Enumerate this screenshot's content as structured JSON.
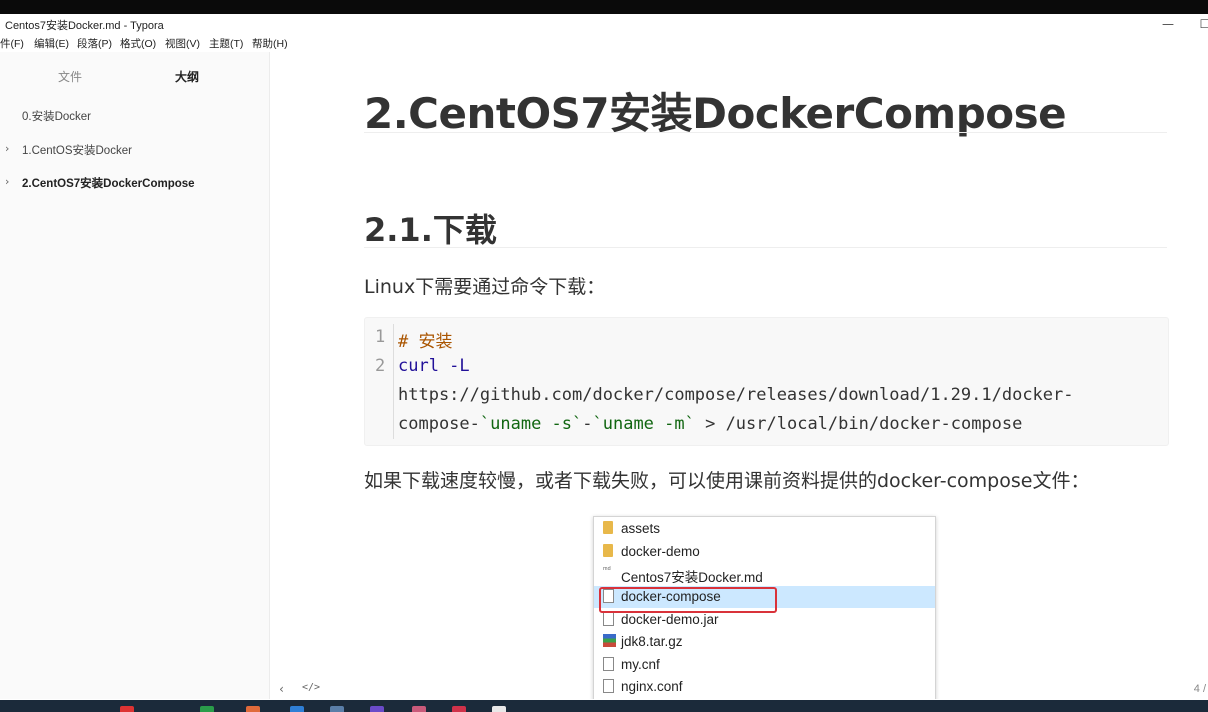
{
  "window": {
    "title": "Centos7安装Docker.md - Typora",
    "minimize_label": "—",
    "maximize_label": "☐"
  },
  "menu": [
    "件(F)",
    "编辑(E)",
    "段落(P)",
    "格式(O)",
    "视图(V)",
    "主题(T)",
    "帮助(H)"
  ],
  "sidebar": {
    "tab_files": "文件",
    "tab_outline": "大纲",
    "outline": [
      {
        "label": "0.安装Docker",
        "expandable": false,
        "active": false
      },
      {
        "label": "1.CentOS安装Docker",
        "expandable": true,
        "active": false
      },
      {
        "label": "2.CentOS7安装DockerCompose",
        "expandable": true,
        "active": true
      }
    ]
  },
  "document": {
    "h1": "2.CentOS7安装DockerCompose",
    "h2": "2.1.下载",
    "para1": "Linux下需要通过命令下载：",
    "code": {
      "line_numbers": [
        "1",
        "2"
      ],
      "comment": "# 安装",
      "cmd": "curl -L",
      "url_line": "https://github.com/docker/compose/releases/download/1.29.1/docker-",
      "line4_prefix": "compose-",
      "sub1": "`uname -s`",
      "dash": "-",
      "sub2": "`uname -m`",
      "line4_suffix": " > /usr/local/bin/docker-compose"
    },
    "para2": "如果下载速度较慢，或者下载失败，可以使用课前资料提供的docker-compose文件："
  },
  "explorer_files": [
    {
      "name": "assets",
      "icon": "folder-icon",
      "selected": false
    },
    {
      "name": "docker-demo",
      "icon": "folder-icon",
      "selected": false
    },
    {
      "name": "Centos7安装Docker.md",
      "icon": "markdown-file-icon",
      "selected": false
    },
    {
      "name": "docker-compose",
      "icon": "file-icon",
      "selected": true
    },
    {
      "name": "docker-demo.jar",
      "icon": "file-icon",
      "selected": false
    },
    {
      "name": "jdk8.tar.gz",
      "icon": "archive-icon",
      "selected": false
    },
    {
      "name": "my.cnf",
      "icon": "file-icon",
      "selected": false
    },
    {
      "name": "nginx.conf",
      "icon": "file-icon",
      "selected": false
    }
  ],
  "status": {
    "back_icon": "‹",
    "source_icon": "</>",
    "word_count": "4 /"
  },
  "colors": {
    "selection": "#cce8ff",
    "highlight_border": "#d9323a",
    "code_comment": "#aa5500",
    "code_keyword": "#221199",
    "code_subshell": "#116611"
  }
}
